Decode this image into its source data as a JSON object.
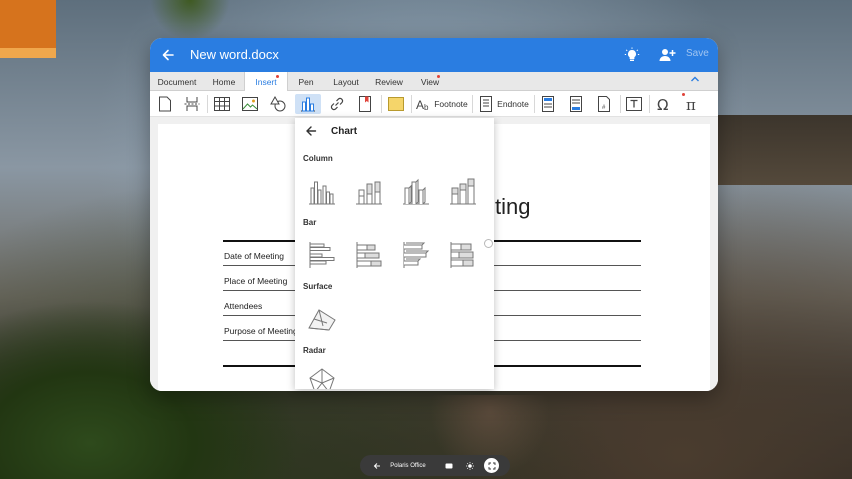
{
  "window": {
    "title": "New word.docx",
    "save_label": "Save"
  },
  "tabs": [
    {
      "label": "Document"
    },
    {
      "label": "Home"
    },
    {
      "label": "Insert"
    },
    {
      "label": "Pen"
    },
    {
      "label": "Layout"
    },
    {
      "label": "Review"
    },
    {
      "label": "View"
    }
  ],
  "ribbon": {
    "footnote_label": "Footnote",
    "endnote_label": "Endnote"
  },
  "document": {
    "heading_fragment": "ting",
    "fields": [
      {
        "label": "Date of Meeting"
      },
      {
        "label": "Place of Meeting"
      },
      {
        "label": "Attendees"
      },
      {
        "label": "Purpose of Meeting"
      }
    ]
  },
  "chart_panel": {
    "title": "Chart",
    "sections": [
      {
        "label": "Column"
      },
      {
        "label": "Bar"
      },
      {
        "label": "Surface"
      },
      {
        "label": "Radar"
      }
    ]
  },
  "taskbar": {
    "app_label": "Polaris Office"
  },
  "colors": {
    "accent": "#2a7de1",
    "notification_dot": "#e0433a",
    "selected_ribbon": "#cfe1f6"
  }
}
